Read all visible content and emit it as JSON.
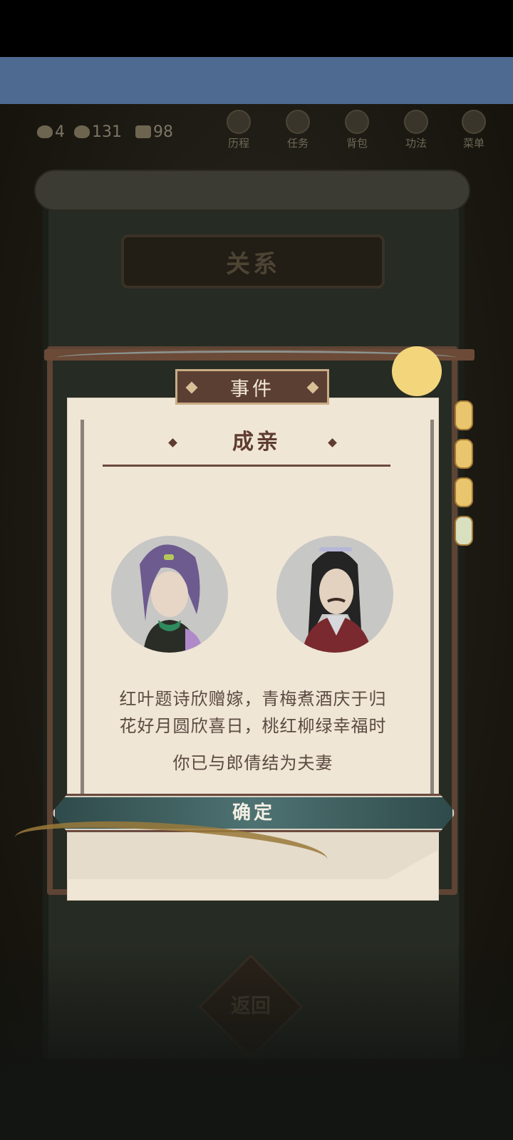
{
  "hud": {
    "resource1_value": "4",
    "resource2_value": "131",
    "resource3_value": "98",
    "nav": [
      {
        "label": "历程",
        "icon": "history-icon"
      },
      {
        "label": "任务",
        "icon": "task-icon"
      },
      {
        "label": "背包",
        "icon": "bag-icon"
      },
      {
        "label": "功法",
        "icon": "skill-book-icon"
      },
      {
        "label": "菜单",
        "icon": "menu-fan-icon"
      }
    ]
  },
  "background": {
    "relation_title": "关系",
    "return_label": "返回"
  },
  "event": {
    "tag": "事件",
    "title": "成亲",
    "story_line1": "红叶题诗欣赠嫁，青梅煮酒庆于归",
    "story_line2": "花好月圆欣喜日，桃红柳绿幸福时",
    "result": "你已与郎倩结为夫妻",
    "confirm_label": "确定"
  },
  "colors": {
    "paper": "#efe6d6",
    "wood": "#5e4434",
    "confirm": "#4e7272",
    "top_bar": "#4e6a90"
  }
}
